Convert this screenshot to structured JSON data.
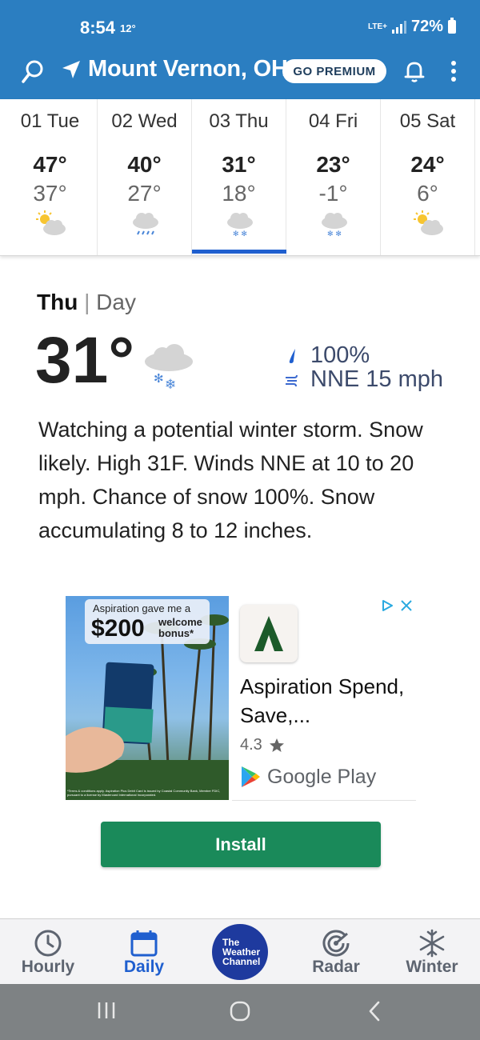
{
  "status": {
    "time": "8:54",
    "temp": "12°",
    "network": "LTE+",
    "battery": "72%"
  },
  "header": {
    "location": "Mount Vernon, OH",
    "premium_label": "GO PREMIUM"
  },
  "days": [
    {
      "name": "01 Tue",
      "hi": "47°",
      "lo": "37°",
      "icon": "partly-cloudy-icon"
    },
    {
      "name": "02 Wed",
      "hi": "40°",
      "lo": "27°",
      "icon": "rain-icon"
    },
    {
      "name": "03 Thu",
      "hi": "31°",
      "lo": "18°",
      "icon": "snow-icon"
    },
    {
      "name": "04 Fri",
      "hi": "23°",
      "lo": "-1°",
      "icon": "snow-icon"
    },
    {
      "name": "05 Sat",
      "hi": "24°",
      "lo": "6°",
      "icon": "partly-cloudy-icon"
    }
  ],
  "selected_day": 2,
  "detail": {
    "day": "Thu",
    "separator": "|",
    "part": "Day",
    "temp": "31°",
    "precip": "100%",
    "wind": "NNE 15 mph",
    "narrative": "Watching a potential winter storm. Snow likely. High 31F. Winds NNE at 10 to 20 mph. Chance of snow 100%. Snow accumulating 8 to 12 inches."
  },
  "ad": {
    "bubble_top": "Aspiration gave me a",
    "bubble_amount": "$200",
    "bubble_sub_1": "welcome",
    "bubble_sub_2": "bonus*",
    "fine_print": "*Terms & conditions apply. Aspiration Plus Debit Card is issued by Coastal Community Bank, Member FDIC, pursuant to a license by Mastercard International Incorporated.",
    "app_name": "Aspiration Spend, Save,...",
    "rating": "4.3",
    "store": "Google Play",
    "install_label": "Install"
  },
  "nav": [
    {
      "label": "Hourly",
      "icon": "clock-icon"
    },
    {
      "label": "Daily",
      "icon": "calendar-icon"
    },
    {
      "label": "The Weather Channel",
      "icon": "twc-logo"
    },
    {
      "label": "Radar",
      "icon": "radar-icon"
    },
    {
      "label": "Winter",
      "icon": "snowflake-icon"
    }
  ],
  "nav_brand": {
    "line1": "The",
    "line2": "Weather",
    "line3": "Channel"
  },
  "colors": {
    "header": "#2b7ec1",
    "accent": "#1f5fcf",
    "install": "#1a8a5a",
    "brand": "#1e3a9e"
  }
}
